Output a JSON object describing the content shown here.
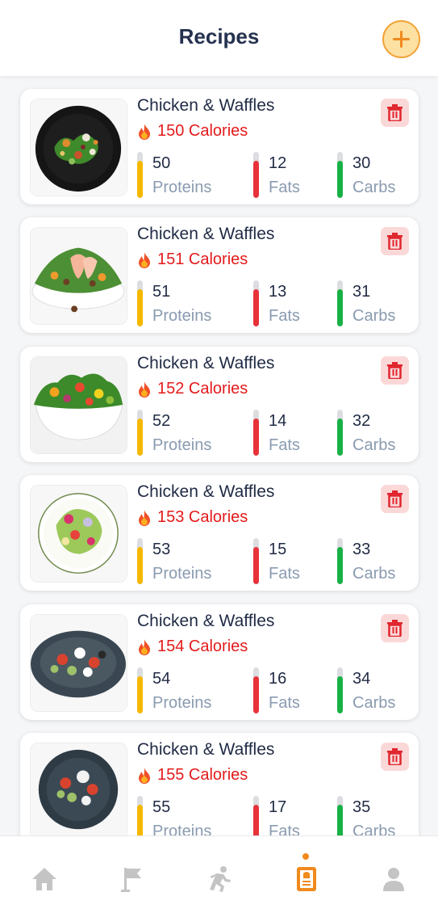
{
  "header": {
    "title": "Recipes"
  },
  "colors": {
    "accent": "#f08a1d",
    "calories": "#e31b1b",
    "proteins": "#f5b800",
    "fats": "#e8323a",
    "carbs": "#18b146",
    "inactive": "#c4c4c4"
  },
  "labels": {
    "proteins": "Proteins",
    "fats": "Fats",
    "carbs": "Carbs"
  },
  "recipes": [
    {
      "name": "Chicken & Waffles",
      "calories": "150 Calories",
      "proteins": "50",
      "fats": "12",
      "carbs": "30",
      "proteins_fill": 0.8,
      "fats_fill": 0.8,
      "carbs_fill": 0.8
    },
    {
      "name": "Chicken & Waffles",
      "calories": "151 Calories",
      "proteins": "51",
      "fats": "13",
      "carbs": "31",
      "proteins_fill": 0.8,
      "fats_fill": 0.8,
      "carbs_fill": 0.8
    },
    {
      "name": "Chicken & Waffles",
      "calories": "152 Calories",
      "proteins": "52",
      "fats": "14",
      "carbs": "32",
      "proteins_fill": 0.8,
      "fats_fill": 0.8,
      "carbs_fill": 0.8
    },
    {
      "name": "Chicken & Waffles",
      "calories": "153 Calories",
      "proteins": "53",
      "fats": "15",
      "carbs": "33",
      "proteins_fill": 0.8,
      "fats_fill": 0.8,
      "carbs_fill": 0.8
    },
    {
      "name": "Chicken & Waffles",
      "calories": "154 Calories",
      "proteins": "54",
      "fats": "16",
      "carbs": "34",
      "proteins_fill": 0.8,
      "fats_fill": 0.8,
      "carbs_fill": 0.8
    },
    {
      "name": "Chicken & Waffles",
      "calories": "155 Calories",
      "proteins": "55",
      "fats": "17",
      "carbs": "35",
      "proteins_fill": 0.8,
      "fats_fill": 0.8,
      "carbs_fill": 0.8
    }
  ],
  "nav": [
    {
      "icon": "home-icon",
      "active": false
    },
    {
      "icon": "flag-icon",
      "active": false
    },
    {
      "icon": "running-icon",
      "active": false
    },
    {
      "icon": "recipe-book-icon",
      "active": true
    },
    {
      "icon": "profile-icon",
      "active": false
    }
  ]
}
